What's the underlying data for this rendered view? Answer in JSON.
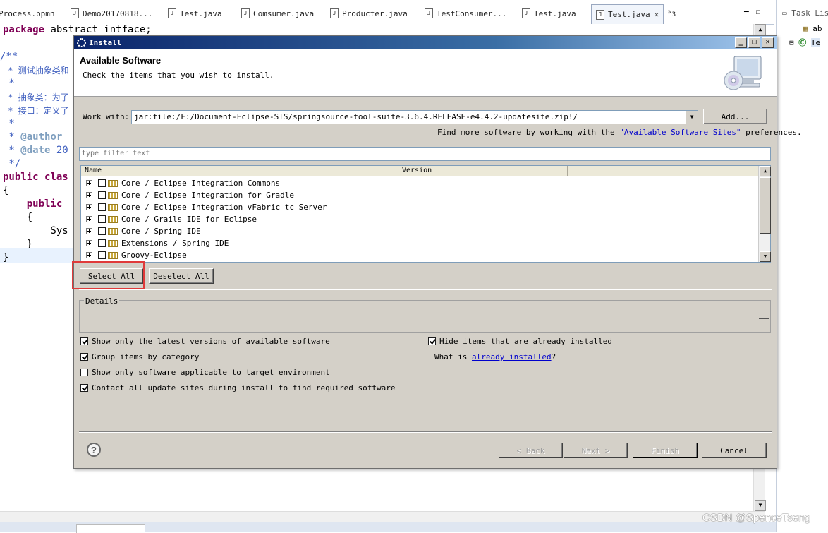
{
  "editor_tabs": [
    {
      "label": "Process.bpmn"
    },
    {
      "label": "Demo20170818..."
    },
    {
      "label": "Test.java"
    },
    {
      "label": "Comsumer.java"
    },
    {
      "label": "Producter.java"
    },
    {
      "label": "TestConsumer..."
    },
    {
      "label": "Test.java"
    },
    {
      "label": "Test.java"
    }
  ],
  "tab_overflow": "»",
  "tab_overflow_count": "3",
  "code_lines": [
    {
      "kw": "package",
      "rest": " abstract intface;"
    },
    {
      "text": "/**"
    },
    {
      "text": " * 测试抽象类和"
    },
    {
      "text": " *"
    },
    {
      "text": " * 抽象类：为了"
    },
    {
      "text": " * 接口：定义了"
    },
    {
      "text": " *"
    },
    {
      "tag": "@author",
      "prefix": " * "
    },
    {
      "tag": "@date",
      "prefix": " * ",
      "rest": " 20"
    },
    {
      "text": " */"
    },
    {
      "kw": "public",
      "rest": " clas"
    },
    {
      "text": "{"
    },
    {
      "kw": "public",
      "indent": "    "
    },
    {
      "text": "    {"
    },
    {
      "text": "        Sys"
    },
    {
      "text": "    }"
    },
    {
      "text": "}"
    }
  ],
  "right_panel": {
    "title": "Task Lis",
    "item1": "ab",
    "item2": "Te"
  },
  "watermark": "CSDN @SpenceTseng",
  "dialog": {
    "title": "Install",
    "heading": "Available Software",
    "subtitle": "Check the items that you wish to install.",
    "work_with_label": "Work with:",
    "work_with_value": "jar:file:/F:/Document-Eclipse-STS/springsource-tool-suite-3.6.4.RELEASE-e4.4.2-updatesite.zip!/",
    "add_button": "Add...",
    "find_more_prefix": "Find more software by working with the ",
    "find_more_link": "\"Available Software Sites\"",
    "find_more_suffix": " preferences.",
    "filter_placeholder": "type filter text",
    "columns": [
      "Name",
      "Version"
    ],
    "items": [
      "Core / Eclipse Integration Commons",
      "Core / Eclipse Integration for Gradle",
      "Core / Eclipse Integration vFabric tc Server",
      "Core / Grails IDE for Eclipse",
      "Core / Spring IDE",
      "Extensions / Spring IDE",
      "Groovy-Eclipse"
    ],
    "select_all": "Select All",
    "deselect_all": "Deselect All",
    "details_label": "Details",
    "options": [
      {
        "label": "Show only the latest versions of available software",
        "checked": true
      },
      {
        "label": "Group items by category",
        "checked": true
      },
      {
        "label": "Show only software applicable to target environment",
        "checked": false
      },
      {
        "label": "Contact all update sites during install to find required software",
        "checked": true
      }
    ],
    "hide_installed": {
      "label": "Hide items that are already installed",
      "checked": true
    },
    "what_is_prefix": "What is ",
    "what_is_link": "already installed",
    "what_is_suffix": "?",
    "help_glyph": "?",
    "back_button": "< Back",
    "next_button": "Next >",
    "finish_button": "Finish",
    "cancel_button": "Cancel"
  },
  "colors": {
    "keyword": "#7f0055",
    "comment": "#3f5fbf",
    "titlebar": "#0a246a",
    "highlight_box": "#e03a3a",
    "link": "#0000cc"
  }
}
